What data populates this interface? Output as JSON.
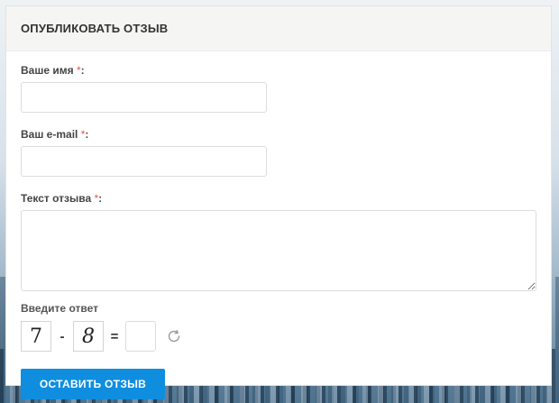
{
  "form": {
    "title": "ОПУБЛИКОВАТЬ ОТЗЫВ",
    "required_mark": "*",
    "colon": ":",
    "name": {
      "label": "Ваше имя",
      "value": "",
      "placeholder": ""
    },
    "email": {
      "label": "Ваш e-mail",
      "value": "",
      "placeholder": ""
    },
    "text": {
      "label": "Текст отзыва",
      "value": "",
      "placeholder": ""
    },
    "captcha": {
      "label": "Введите ответ",
      "operand_a": "7",
      "operator": "-",
      "operand_b": "8",
      "equals": "=",
      "answer": "",
      "refresh_icon": "refresh-icon"
    },
    "submit_label": "ОСТАВИТЬ ОТЗЫВ"
  },
  "colors": {
    "accent": "#0f8ee0",
    "required": "#e2574c",
    "header_bg": "#f5f5f3"
  }
}
